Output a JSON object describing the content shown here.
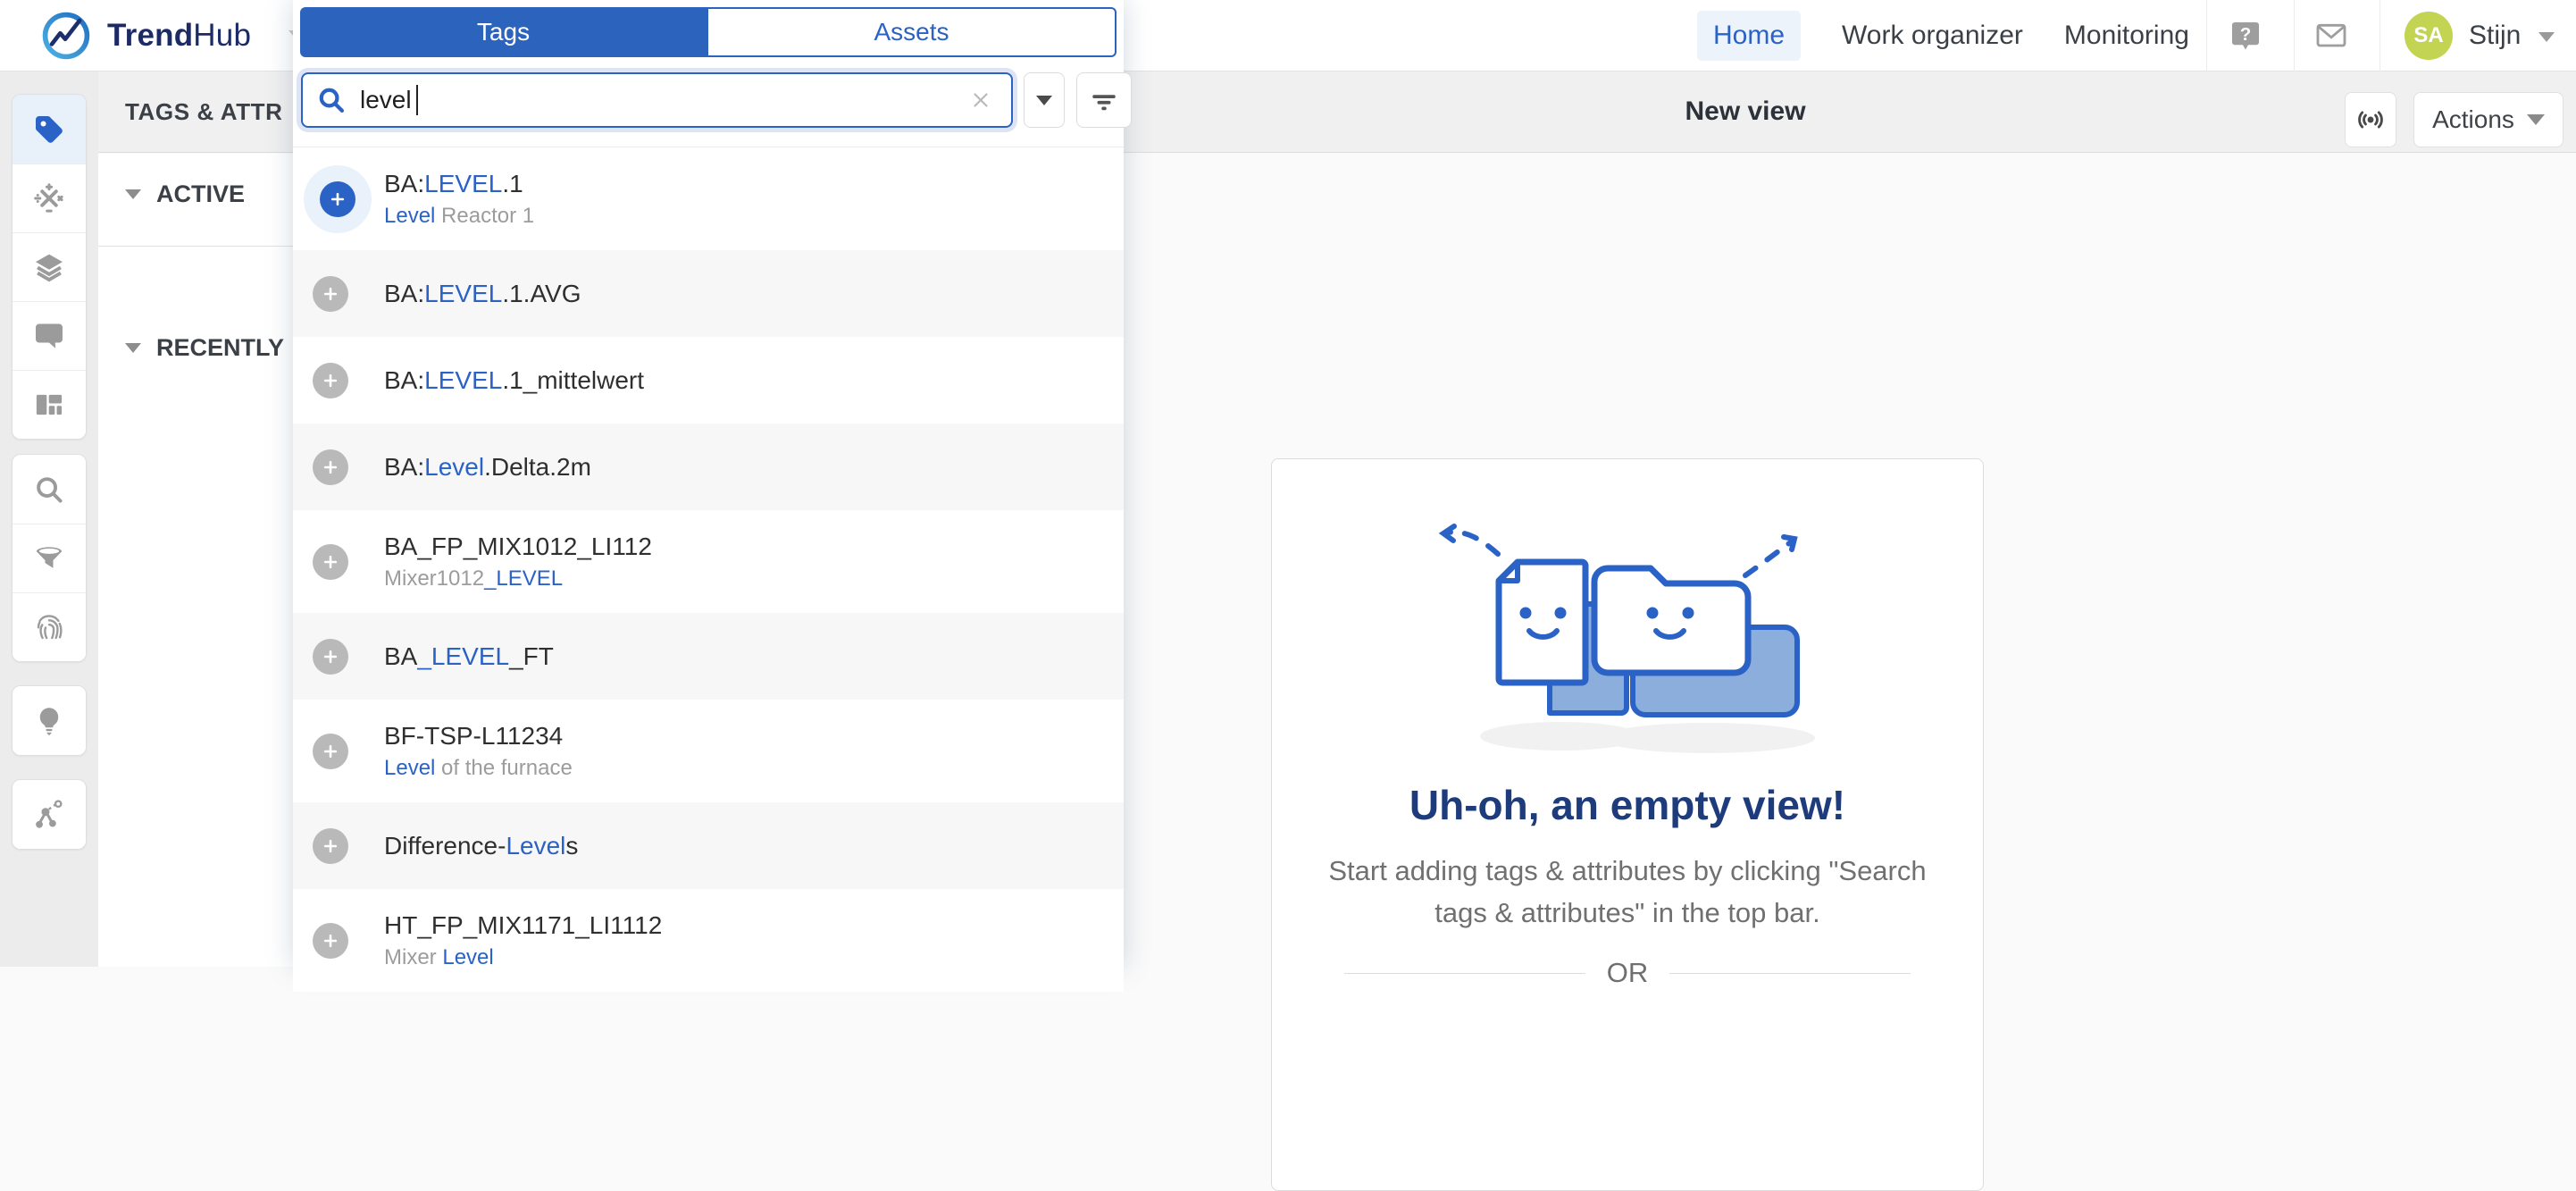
{
  "colors": {
    "primary_blue": "#2b62c6",
    "tab_blue": "#2c63bd",
    "avatar_green": "#c3d452",
    "headline_navy": "#1e3c7c",
    "active_nav_bg": "#edf3fb",
    "row_alt": "#f7f7f7"
  },
  "header": {
    "brand": {
      "bold": "Trend",
      "rest": "Hub",
      "logo_icon": "trendhub-logo-icon"
    },
    "nav": [
      {
        "label": "Home",
        "active": true
      },
      {
        "label": "Work organizer",
        "active": false
      },
      {
        "label": "Monitoring",
        "active": false
      }
    ],
    "icons": [
      "help-icon",
      "mail-icon"
    ],
    "user": {
      "initials": "SA",
      "name": "Stijn"
    }
  },
  "toolbar": {
    "panel_title": "TAGS & ATTR",
    "view_title": "New view",
    "live_icon": "broadcast-icon",
    "actions_label": "Actions"
  },
  "sidebar": {
    "groups": [
      [
        {
          "icon": "tag",
          "active": true
        },
        {
          "icon": "math-functions",
          "active": false
        },
        {
          "icon": "layers",
          "active": false
        },
        {
          "icon": "comment",
          "active": false
        },
        {
          "icon": "dashboard-layout",
          "active": false
        }
      ],
      [
        {
          "icon": "search",
          "active": false
        },
        {
          "icon": "filter",
          "active": false
        },
        {
          "icon": "fingerprint",
          "active": false
        }
      ],
      [
        {
          "icon": "lightbulb",
          "active": false
        }
      ],
      [
        {
          "icon": "node-graph",
          "active": false
        }
      ]
    ]
  },
  "tags_panel": {
    "sections": [
      {
        "label": "ACTIVE"
      },
      {
        "label": "RECENTLY"
      }
    ]
  },
  "search_popup": {
    "tabs": [
      {
        "label": "Tags",
        "active": true
      },
      {
        "label": "Assets",
        "active": false
      }
    ],
    "search_value": "level",
    "results": [
      {
        "title": [
          [
            "BA:",
            "d"
          ],
          [
            "LEVEL",
            "b"
          ],
          [
            ".1",
            "d"
          ]
        ],
        "subtitle": [
          [
            "Level",
            "b"
          ],
          [
            " Reactor 1",
            "g"
          ]
        ],
        "plus_active": true
      },
      {
        "title": [
          [
            "BA:",
            "d"
          ],
          [
            "LEVEL",
            "b"
          ],
          [
            ".1.AVG",
            "d"
          ]
        ],
        "plus_active": false
      },
      {
        "title": [
          [
            "BA:",
            "d"
          ],
          [
            "LEVEL",
            "b"
          ],
          [
            ".1_mittelwert",
            "d"
          ]
        ],
        "plus_active": false
      },
      {
        "title": [
          [
            "BA:",
            "d"
          ],
          [
            "Level",
            "b"
          ],
          [
            ".Delta.2m",
            "d"
          ]
        ],
        "plus_active": false
      },
      {
        "title": [
          [
            "BA_FP_MIX1012_LI112",
            "d"
          ]
        ],
        "subtitle": [
          [
            "Mixer1012",
            "g"
          ],
          [
            "_LEVEL",
            "b"
          ]
        ],
        "plus_active": false
      },
      {
        "title": [
          [
            "BA",
            "d"
          ],
          [
            "_LEVEL",
            "b"
          ],
          [
            "_FT",
            "d"
          ]
        ],
        "plus_active": false
      },
      {
        "title": [
          [
            "BF-TSP-L11234",
            "d"
          ]
        ],
        "subtitle": [
          [
            "Level",
            "b"
          ],
          [
            " of the furnace",
            "g"
          ]
        ],
        "plus_active": false
      },
      {
        "title": [
          [
            "Difference-",
            "d"
          ],
          [
            "Level",
            "b"
          ],
          [
            "s",
            "d"
          ]
        ],
        "plus_active": false
      },
      {
        "title": [
          [
            "HT_FP_MIX1171_LI1112",
            "d"
          ]
        ],
        "subtitle": [
          [
            "Mixer ",
            "g"
          ],
          [
            "Level",
            "b"
          ]
        ],
        "plus_active": false
      }
    ]
  },
  "empty_state": {
    "title": "Uh-oh, an empty view!",
    "description": "Start adding tags & attributes by clicking \"Search tags & attributes\" in the top bar.",
    "divider_label": "OR",
    "illustration": "document-and-folder-smiley-illustration"
  }
}
